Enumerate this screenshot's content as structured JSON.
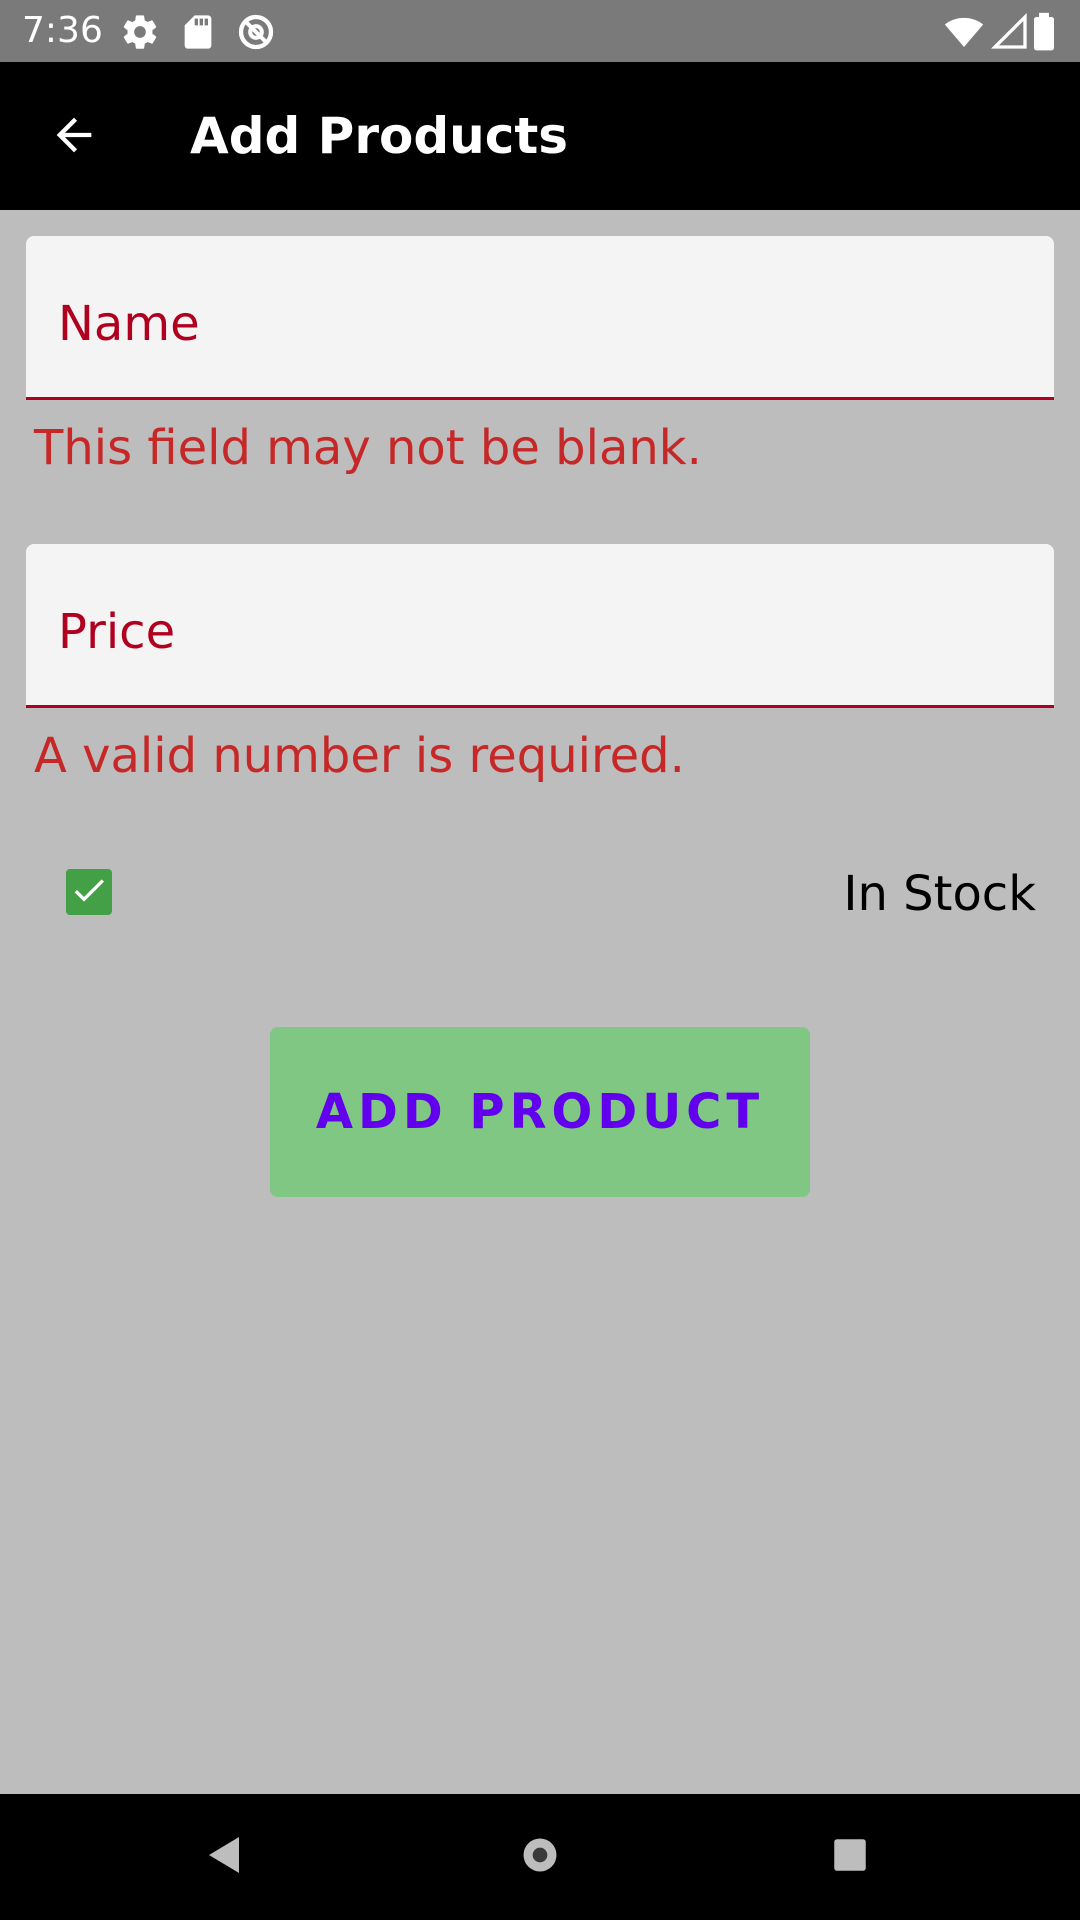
{
  "status_bar": {
    "time": "7:36",
    "left_icons": [
      "gear-icon",
      "sd-card-icon",
      "do-not-disturb-icon"
    ],
    "right_icons": [
      "wifi-icon",
      "signal-icon",
      "battery-icon"
    ]
  },
  "app_bar": {
    "title": "Add Products",
    "back_icon": "arrow-back-icon"
  },
  "form": {
    "name_field": {
      "label": "Name",
      "value": "",
      "error": "This field may not be blank."
    },
    "price_field": {
      "label": "Price",
      "value": "",
      "error": "A valid number is required."
    },
    "in_stock": {
      "label": "In Stock",
      "checked": true
    },
    "submit_label": "ADD PRODUCT"
  },
  "nav_bar": {
    "buttons": [
      "back-triangle-icon",
      "home-circle-icon",
      "recents-square-icon"
    ]
  },
  "colors": {
    "error": "#c62828",
    "field_label": "#b0001f",
    "checkbox": "#43a047",
    "button_bg": "#81c784",
    "button_text": "#6200ee",
    "background": "#bdbdbd"
  }
}
